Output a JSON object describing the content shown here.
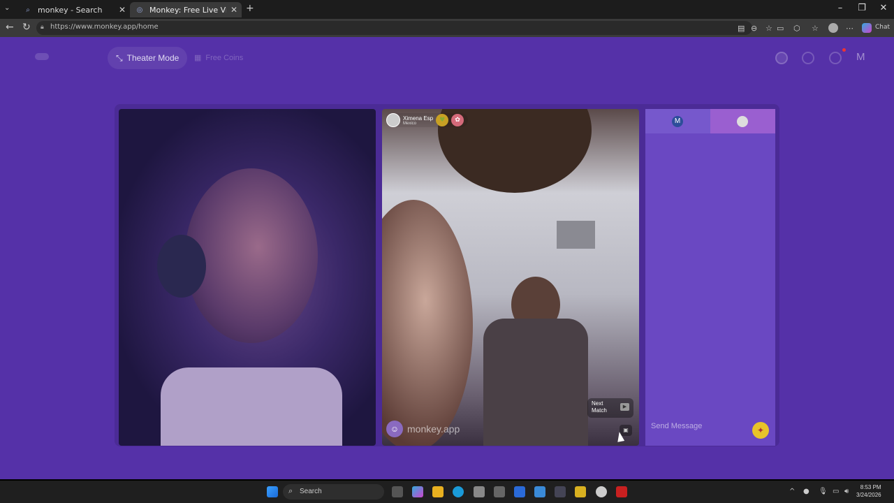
{
  "browser": {
    "tabs": [
      {
        "title": "monkey - Search",
        "icon": "search-icon"
      },
      {
        "title": "Monkey: Free Live Video Chat",
        "icon": "globe-icon"
      }
    ],
    "url": "https://www.monkey.app/home"
  },
  "copilot_label": "Chat",
  "topnav": {
    "theater_mode": "Theater Mode",
    "free_coins": "Free Coins",
    "account_initial": "M"
  },
  "match": {
    "user_name": "Ximena Esp",
    "user_location": "Mexico",
    "next_match_label": "Next Match",
    "watermark": "monkey.app"
  },
  "chat": {
    "self_initial": "M",
    "placeholder": "Send Message"
  },
  "taskbar": {
    "search_placeholder": "Search",
    "time": "8:53 PM",
    "date": "3/24/2026"
  },
  "colors": {
    "page_bg": "#5531a8",
    "stage_bg": "#4b2b96",
    "chat_bg": "#6a48c2"
  }
}
